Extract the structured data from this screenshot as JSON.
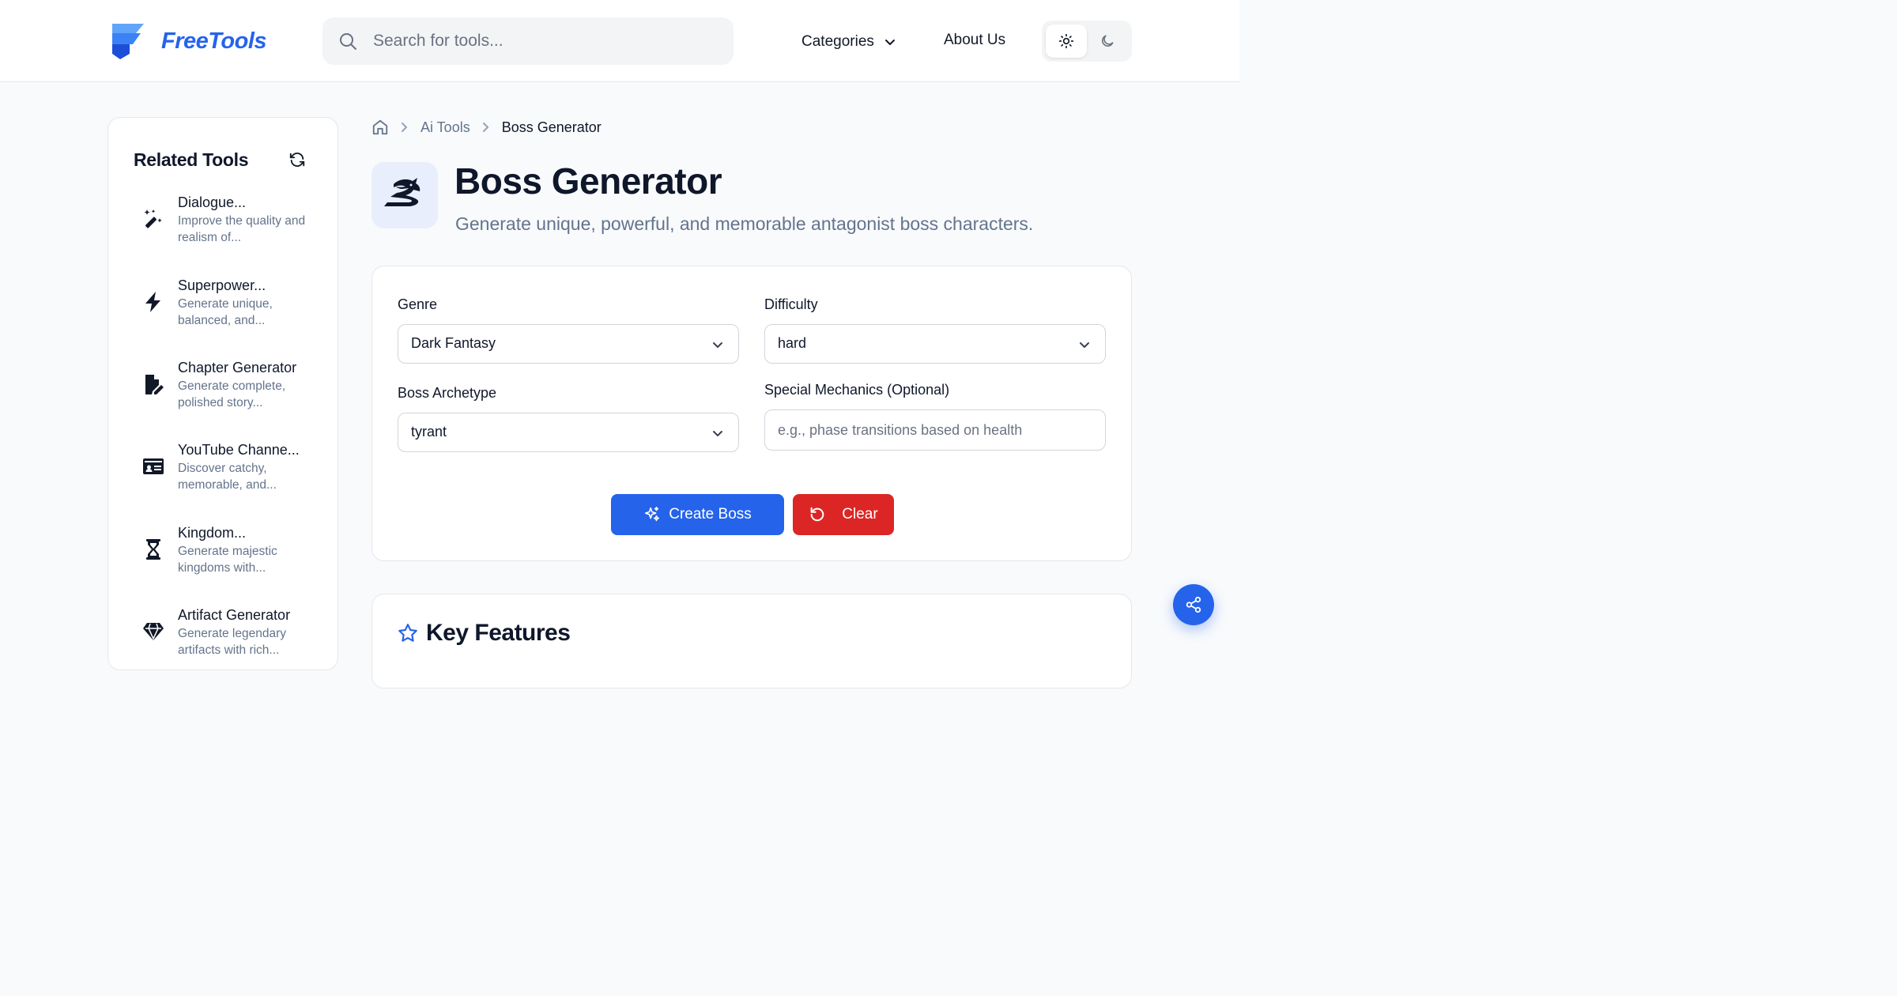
{
  "header": {
    "brand": "FreeTools",
    "search_placeholder": "Search for tools...",
    "nav_categories": "Categories",
    "nav_about": "About Us"
  },
  "sidebar": {
    "title": "Related Tools",
    "items": [
      {
        "name": "Dialogue...",
        "desc": "Improve the quality and realism of...",
        "icon": "magic-wand-icon"
      },
      {
        "name": "Superpower...",
        "desc": "Generate unique, balanced, and...",
        "icon": "lightning-bolt-icon"
      },
      {
        "name": "Chapter Generator",
        "desc": "Generate complete, polished story...",
        "icon": "file-pen-icon"
      },
      {
        "name": "YouTube Channe...",
        "desc": "Discover catchy, memorable, and...",
        "icon": "id-card-icon"
      },
      {
        "name": "Kingdom...",
        "desc": "Generate majestic kingdoms with...",
        "icon": "hourglass-icon"
      },
      {
        "name": "Artifact Generator",
        "desc": "Generate legendary artifacts with rich...",
        "icon": "gem-icon"
      }
    ]
  },
  "breadcrumb": {
    "parent": "Ai Tools",
    "current": "Boss Generator"
  },
  "page": {
    "title": "Boss Generator",
    "subtitle": "Generate unique, powerful, and memorable antagonist boss characters."
  },
  "form": {
    "genre_label": "Genre",
    "genre_value": "Dark Fantasy",
    "difficulty_label": "Difficulty",
    "difficulty_value": "hard",
    "archetype_label": "Boss Archetype",
    "archetype_value": "tyrant",
    "mechanics_label": "Special Mechanics (Optional)",
    "mechanics_placeholder": "e.g., phase transitions based on health",
    "create_label": "Create Boss",
    "clear_label": "Clear"
  },
  "features": {
    "title": "Key Features"
  },
  "colors": {
    "accent": "#2563eb",
    "danger": "#dc2626",
    "muted_text": "#64748b"
  }
}
